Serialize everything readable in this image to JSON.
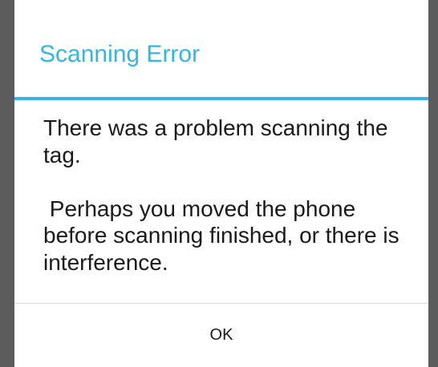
{
  "dialog": {
    "title": "Scanning Error",
    "message": "There was a problem scanning the tag.\n\n Perhaps you moved the phone before scanning finished, or there is interference.",
    "ok_label": "OK"
  },
  "colors": {
    "accent": "#33b5e5",
    "backdrop": "#5c5c5c",
    "surface": "#ffffff",
    "text": "#1a1a1a"
  }
}
